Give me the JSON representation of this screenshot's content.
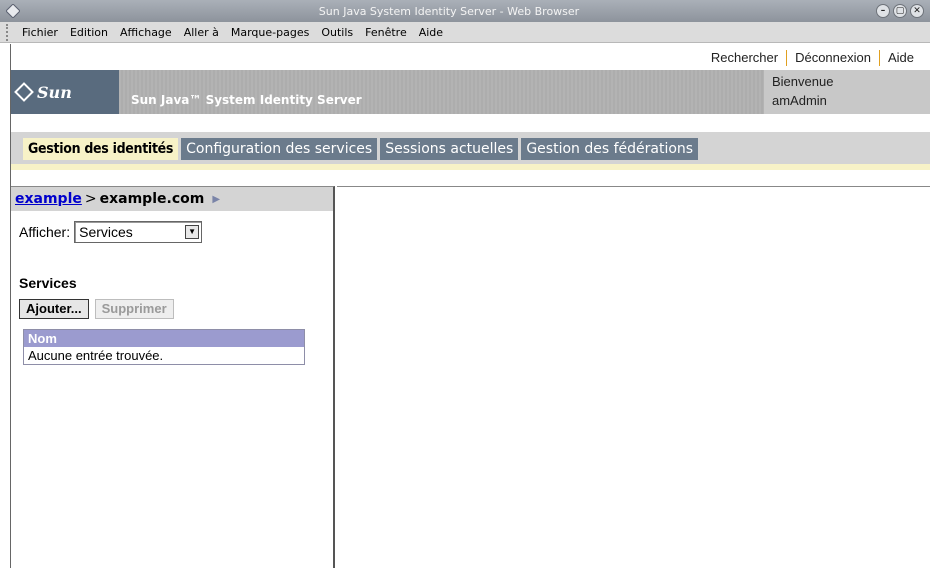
{
  "window": {
    "title": "Sun Java System Identity Server - Web Browser",
    "controls": [
      "–",
      "▢",
      "✕"
    ]
  },
  "menubar": {
    "items": [
      {
        "label": "Fichier"
      },
      {
        "label": "Edition"
      },
      {
        "label": "Affichage"
      },
      {
        "label": "Aller à"
      },
      {
        "label": "Marque-pages"
      },
      {
        "label": "Outils"
      },
      {
        "label": "Fenêtre"
      },
      {
        "label": "Aide"
      }
    ]
  },
  "utility": {
    "search": "Rechercher",
    "logout": "Déconnexion",
    "help": "Aide"
  },
  "masthead": {
    "logo": "Sun",
    "product": "Sun Java™ System Identity Server",
    "welcome_line1": "Bienvenue",
    "welcome_line2": "amAdmin"
  },
  "tabs": [
    {
      "label": "Gestion des identités",
      "active": true
    },
    {
      "label": "Configuration des services",
      "active": false
    },
    {
      "label": "Sessions actuelles",
      "active": false
    },
    {
      "label": "Gestion des fédérations",
      "active": false
    }
  ],
  "nav": {
    "crumb_link": "example",
    "crumb_sep": ">",
    "crumb_current": "example.com",
    "view_label": "Afficher:",
    "view_value": "Services",
    "section_title": "Services",
    "add_button": "Ajouter...",
    "delete_button": "Supprimer",
    "column_header": "Nom",
    "empty_message": "Aucune entrée trouvée."
  },
  "colors": {
    "active_tab": "#f7f2c7",
    "inactive_tab": "#6b7b8c",
    "table_header": "#9b9bcf",
    "link": "#0000cc"
  }
}
